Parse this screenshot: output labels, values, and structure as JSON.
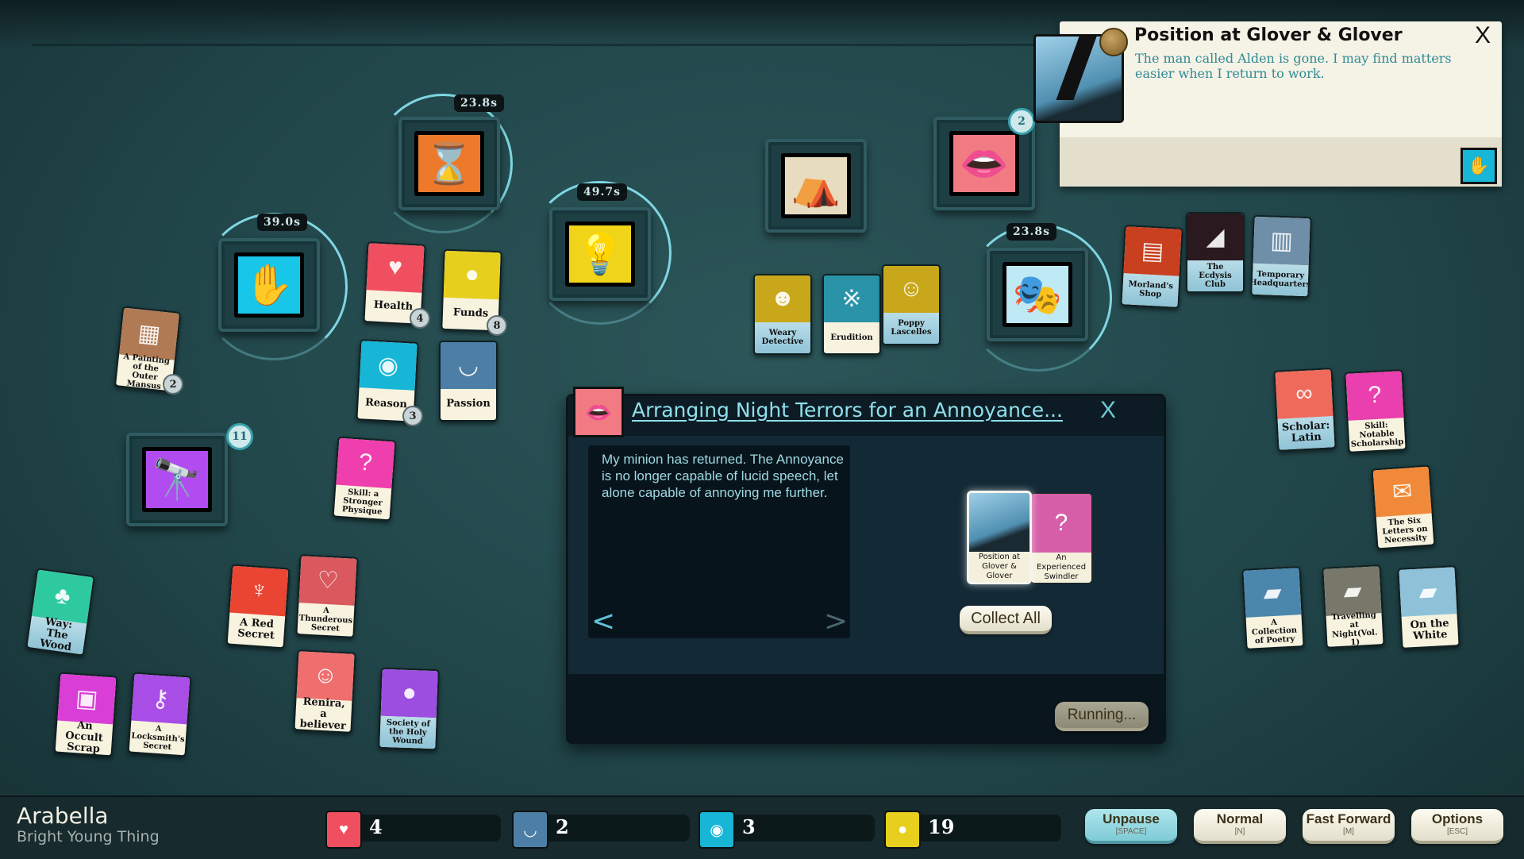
{
  "verbs": [
    {
      "id": "time",
      "icon": "hourglass-icon",
      "glyph": "⌛",
      "color": "#ec7a2a",
      "timer": "23.8s"
    },
    {
      "id": "work",
      "icon": "hand-eye-icon",
      "glyph": "✋",
      "color": "#18c6ea",
      "timer": "39.0s"
    },
    {
      "id": "study",
      "icon": "lightbulb-icon",
      "glyph": "💡",
      "color": "#f0d41a",
      "timer": "49.7s"
    },
    {
      "id": "explore-tent",
      "icon": "tent-icon",
      "glyph": "⛺",
      "color": "#e8dcc0"
    },
    {
      "id": "talk",
      "icon": "lips-icon",
      "glyph": "👄",
      "color": "#f27b83",
      "badge": "2"
    },
    {
      "id": "dream",
      "icon": "mask-icon",
      "glyph": "🎭",
      "color": "#bfe9f4",
      "timer": "23.8s"
    },
    {
      "id": "explore",
      "icon": "telescope-icon",
      "glyph": "🔭",
      "color": "#b04cf0",
      "badge": "11"
    }
  ],
  "cards": [
    {
      "label": "A Painting of the Outer Mansus",
      "color": "#b07a55",
      "glyph": "▦",
      "badge": "2"
    },
    {
      "label": "Health",
      "color": "#ef4f5f",
      "glyph": "♥",
      "badge": "4",
      "big": true
    },
    {
      "label": "Funds",
      "color": "#e7cf1e",
      "glyph": "●",
      "badge": "8",
      "big": true
    },
    {
      "label": "Reason",
      "color": "#18b6d6",
      "glyph": "◉",
      "badge": "3",
      "big": true
    },
    {
      "label": "Passion",
      "color": "#4d7fa6",
      "glyph": "◡",
      "big": true
    },
    {
      "label": "Skill: a Stronger Physique",
      "color": "#ef3fae",
      "glyph": "?"
    },
    {
      "label": "Way: The Wood",
      "color": "#2fc9a0",
      "glyph": "♣",
      "big": true,
      "blue": true
    },
    {
      "label": "A Red Secret",
      "color": "#ea4433",
      "glyph": "♆",
      "big": true
    },
    {
      "label": "A Thunderous Secret",
      "color": "#d9595f",
      "glyph": "♡"
    },
    {
      "label": "An Occult Scrap",
      "color": "#d93ed6",
      "glyph": "▣",
      "big": true
    },
    {
      "label": "A Locksmith's Secret",
      "color": "#a84ee6",
      "glyph": "⚷"
    },
    {
      "label": "Renira, a believer",
      "color": "#ef6f6f",
      "glyph": "☺",
      "big": true
    },
    {
      "label": "Society of the Holy Wound",
      "color": "#9b4ee0",
      "glyph": "●",
      "blue": true
    },
    {
      "label": "Weary Detective",
      "color": "#c8a81a",
      "glyph": "☻",
      "blue": true
    },
    {
      "label": "Erudition",
      "color": "#2a93a8",
      "glyph": "※"
    },
    {
      "label": "Poppy Lascelles",
      "color": "#c8a81a",
      "glyph": "☺",
      "blue": true
    },
    {
      "label": "Morland's Shop",
      "color": "#c8401f",
      "glyph": "▤",
      "blue": true
    },
    {
      "label": "The Ecdysis Club",
      "color": "#2a1a20",
      "glyph": "◢",
      "blue": true
    },
    {
      "label": "Temporary Headquarters",
      "color": "#6f8fa8",
      "glyph": "▥",
      "blue": true
    },
    {
      "label": "Scholar: Latin",
      "color": "#ef6a5a",
      "glyph": "∞",
      "big": true,
      "blue": true
    },
    {
      "label": "Skill: Notable Scholarship",
      "color": "#ea3fae",
      "glyph": "?"
    },
    {
      "label": "The Six Letters on Necessity",
      "color": "#f08a3a",
      "glyph": "✉"
    },
    {
      "label": "A Collection of Poetry",
      "color": "#4b86ad",
      "glyph": "▰"
    },
    {
      "label": "Travelling at Night(Vol. 1)",
      "color": "#77786a",
      "glyph": "▰"
    },
    {
      "label": "On the White",
      "color": "#8fc2d8",
      "glyph": "▰",
      "big": true
    }
  ],
  "notification": {
    "title": "Position at Glover & Glover",
    "text": "The man called Alden is gone. I may find matters easier when I return to work.",
    "close": "X"
  },
  "dialog": {
    "title": "Arranging Night Terrors for an Annoyance...",
    "close": "X",
    "text": "My minion has returned. The Annoyance is no longer capable of lucid speech, let alone capable of annoying me further.",
    "prev": "<",
    "next": ">",
    "output_cards": [
      {
        "label": "Position at Glover & Glover",
        "color": "#5f9fc4"
      },
      {
        "label": "An Experienced Swindler",
        "color": "#d65ea8"
      }
    ],
    "collect_all": "Collect All",
    "running": "Running..."
  },
  "player": {
    "name": "Arabella",
    "title": "Bright Young Thing"
  },
  "resources": [
    {
      "name": "health",
      "icon": "heart-icon",
      "glyph": "♥",
      "color": "#ef4f5f",
      "value": "4"
    },
    {
      "name": "passion",
      "icon": "closed-eye-icon",
      "glyph": "◡",
      "color": "#4d7fa6",
      "value": "2"
    },
    {
      "name": "reason",
      "icon": "eye-icon",
      "glyph": "◉",
      "color": "#18b6d6",
      "value": "3"
    },
    {
      "name": "funds",
      "icon": "coin-icon",
      "glyph": "●",
      "color": "#e7cf1e",
      "value": "19"
    }
  ],
  "controls": [
    {
      "label": "Unpause",
      "key": "[SPACE]",
      "active": true
    },
    {
      "label": "Normal",
      "key": "[N]"
    },
    {
      "label": "Fast Forward",
      "key": "[M]"
    },
    {
      "label": "Options",
      "key": "[ESC]"
    }
  ]
}
